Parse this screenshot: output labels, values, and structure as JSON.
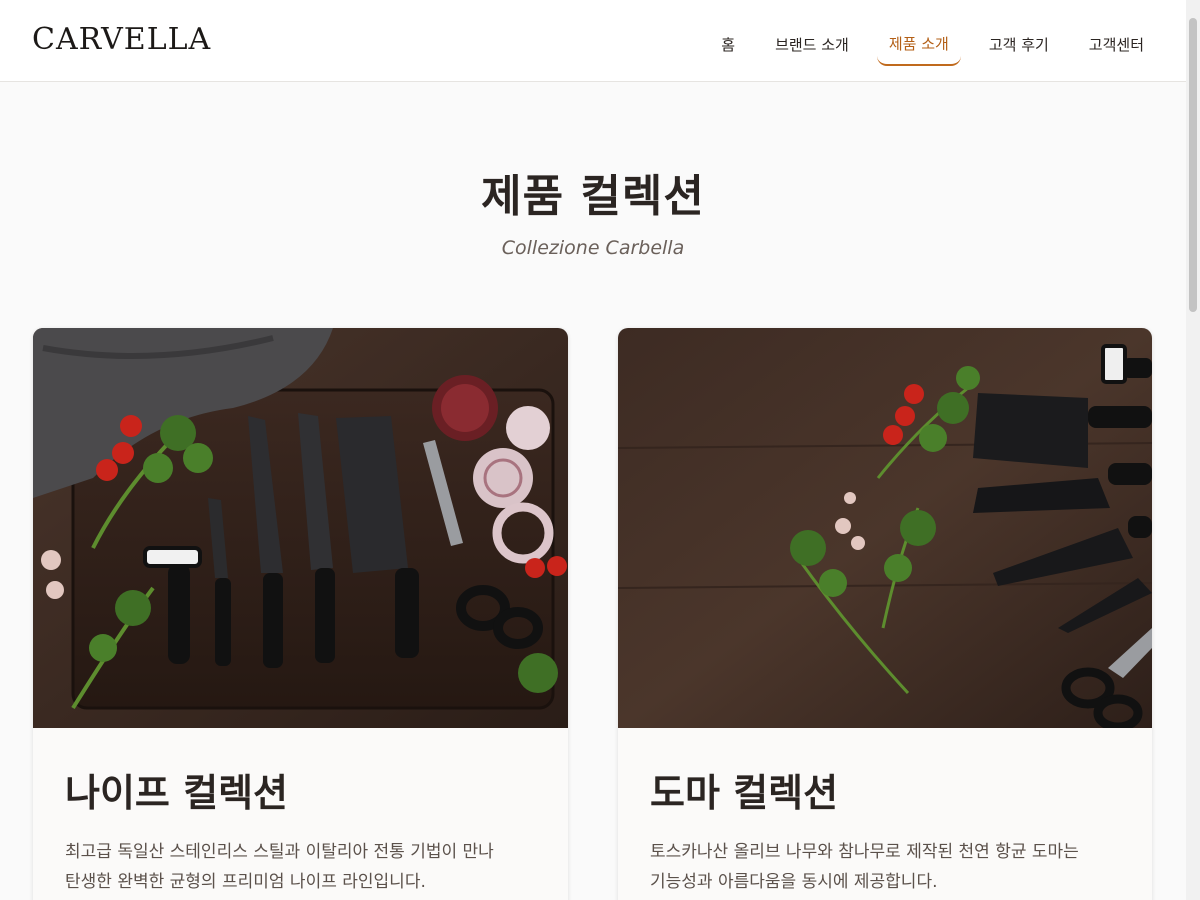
{
  "header": {
    "logo": "CARVELLA",
    "nav": [
      "홈",
      "브랜드 소개",
      "제품 소개",
      "고객 후기",
      "고객센터"
    ],
    "active_nav": "제품 소개"
  },
  "hero": {
    "title": "제품 컬렉션",
    "subtitle": "Collezione Carbella"
  },
  "cards": [
    {
      "title": "나이프 컬렉션",
      "description_line1": "최고급 독일산 스테인리스 스틸과 이탈리아 전통 기법이 만나",
      "description_line2": "탄생한 완벽한 균형의 프리미엄 나이프 라인입니다."
    },
    {
      "title": "도마 컬렉션",
      "description_line1": "토스카나산 올리브 나무와 참나무로 제작된 천연 항균 도마는",
      "description_line2": "기능성과 아름다움을 동시에 제공합니다."
    }
  ],
  "colors": {
    "accent": "#c06a1d",
    "text": "#2b2522",
    "wood": "#3a2a22"
  }
}
